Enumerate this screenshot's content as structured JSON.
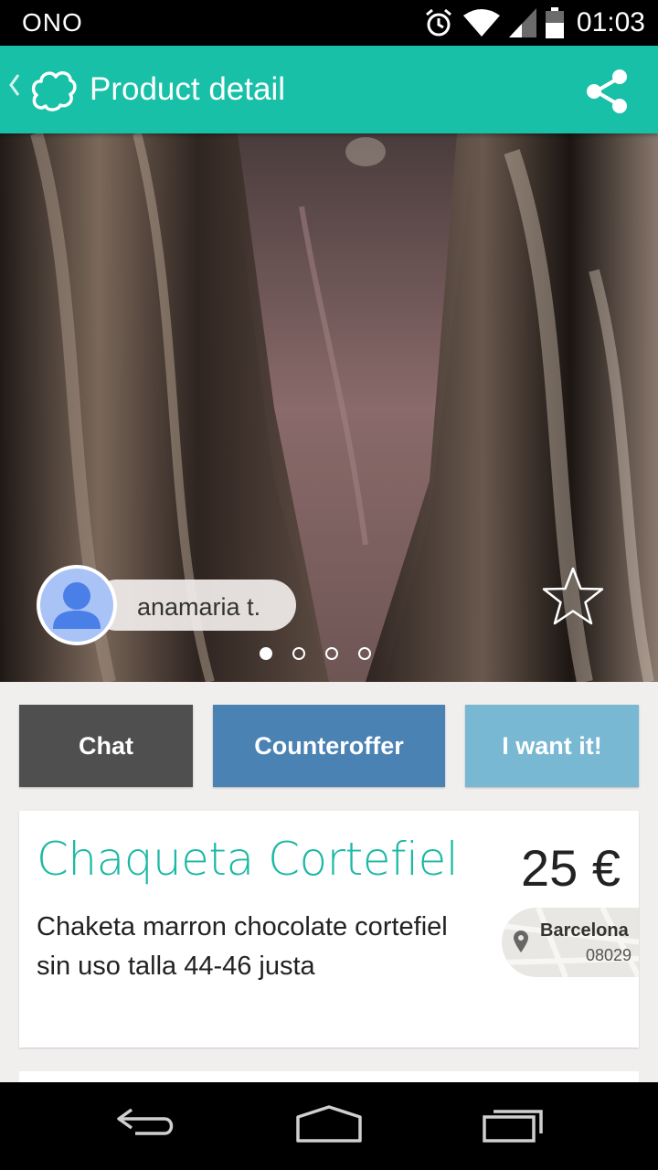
{
  "status_bar": {
    "carrier": "ONO",
    "time": "01:03",
    "icons": [
      "alarm-icon",
      "wifi-icon",
      "signal-icon",
      "battery-icon"
    ]
  },
  "app_bar": {
    "title": "Product detail",
    "background": "#19c0a8",
    "icons": [
      "back-chevron-icon",
      "app-logo-icon",
      "share-icon"
    ]
  },
  "hero": {
    "seller_name": "anamaria t.",
    "image_count": 4,
    "active_image": 1
  },
  "actions": {
    "chat_label": "Chat",
    "counteroffer_label": "Counteroffer",
    "want_label": "I want it!",
    "colors": {
      "chat": "#4f4f4f",
      "counteroffer": "#4a82b4",
      "want": "#78b8d3"
    }
  },
  "product": {
    "title": "Chaqueta Cortefiel",
    "price": "25 €",
    "description": "Chaketa marron chocolate cortefiel sin uso talla 44-46 justa",
    "location": {
      "city": "Barcelona",
      "zip": "08029"
    }
  }
}
